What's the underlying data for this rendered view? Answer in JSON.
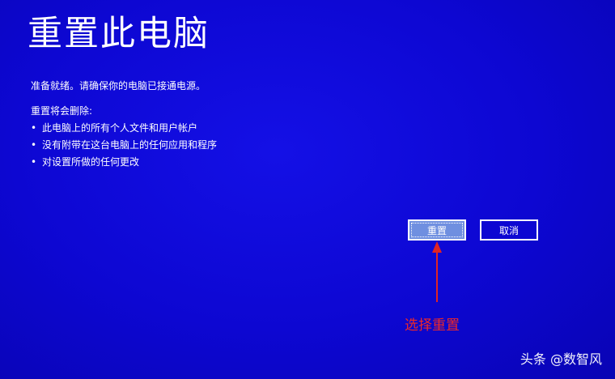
{
  "screen": {
    "title": "重置此电脑",
    "intro": "准备就绪。请确保你的电脑已接通电源。",
    "section_label": "重置将会删除:",
    "bullets": [
      "此电脑上的所有个人文件和用户帐户",
      "没有附带在这台电脑上的任何应用和程序",
      "对设置所做的任何更改"
    ],
    "bullet_glyph": "•"
  },
  "buttons": {
    "reset_label": "重置",
    "cancel_label": "取消"
  },
  "annotation": {
    "text": "选择重置",
    "color": "#f02828"
  },
  "watermark": {
    "text": "头条 @数智风"
  },
  "colors": {
    "background": "#0d07d2",
    "reset_button": "#6f8fe0",
    "text": "#ffffff"
  }
}
